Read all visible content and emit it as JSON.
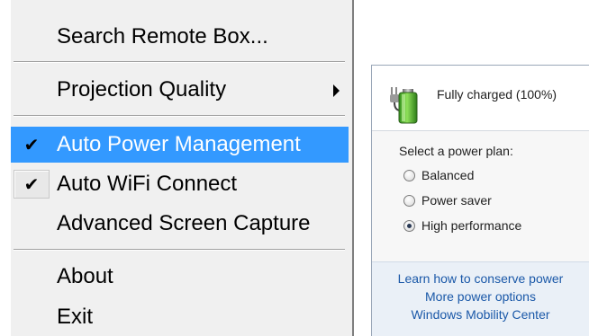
{
  "context_menu": {
    "items": [
      {
        "label": "Search Remote Box...",
        "checked": false,
        "has_submenu": false
      },
      {
        "label": "Projection Quality",
        "checked": false,
        "has_submenu": true
      },
      {
        "label": "Auto Power Management",
        "checked": true,
        "has_submenu": false,
        "highlighted": true
      },
      {
        "label": "Auto WiFi Connect",
        "checked": true,
        "has_submenu": false
      },
      {
        "label": "Advanced Screen Capture",
        "checked": false,
        "has_submenu": false
      },
      {
        "label": "About",
        "checked": false,
        "has_submenu": false
      },
      {
        "label": "Exit",
        "checked": false,
        "has_submenu": false
      }
    ],
    "check_glyph": "✔",
    "highlight_color": "#3399ff"
  },
  "power_flyout": {
    "battery_icon": "battery-charged-icon",
    "battery_status": "Fully charged (100%)",
    "plan_heading": "Select a power plan:",
    "plans": [
      {
        "label": "Balanced",
        "selected": false
      },
      {
        "label": "Power saver",
        "selected": false
      },
      {
        "label": "High performance",
        "selected": true
      }
    ],
    "links": [
      "Learn how to conserve power",
      "More power options",
      "Windows Mobility Center"
    ],
    "link_color": "#1a58a8"
  }
}
